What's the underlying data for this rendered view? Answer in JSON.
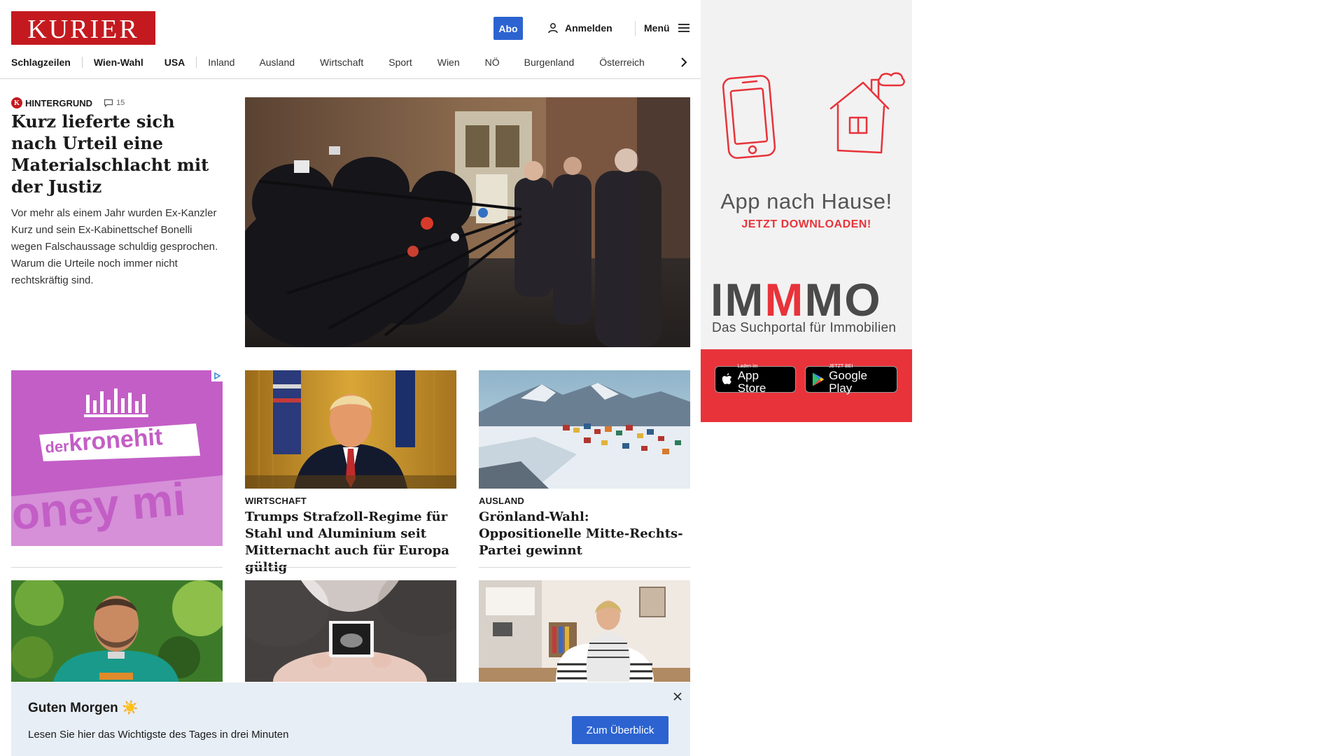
{
  "header": {
    "logo": "KURIER",
    "abo_label": "Abo",
    "login_label": "Anmelden",
    "menu_label": "Menü",
    "nav": [
      "Schlagzeilen",
      "Wien-Wahl",
      "USA",
      "Inland",
      "Ausland",
      "Wirtschaft",
      "Sport",
      "Wien",
      "NÖ",
      "Burgenland",
      "Österreich"
    ]
  },
  "lead": {
    "kicker": "HINTERGRUND",
    "comments": "15",
    "title": "Kurz lieferte sich nach Urteil eine Materialschlacht mit der Justiz",
    "teaser": "Vor mehr als einem Jahr wurden Ex-Kanzler Kurz und sein Ex-Kabinettschef Bonelli wegen Falschaussage schuldig gesprochen. Warum die Urteile noch immer nicht rechtskräftig sind."
  },
  "ad_kronehit": {
    "brand_pre": "der",
    "brand": "kronehit",
    "slogan_fragment": "oney mi"
  },
  "cards": [
    {
      "kicker": "WIRTSCHAFT",
      "title": "Trumps Strafzoll-Regime für Stahl und Aluminium seit Mitternacht auch für Europa gültig"
    },
    {
      "kicker": "AUSLAND",
      "title": "Grönland-Wahl: Oppositionelle Mitte-Rechts-Partei gewinnt"
    }
  ],
  "side_ad": {
    "headline": "App nach Hause!",
    "sub": "JETZT DOWNLOADEN!",
    "brand_a": "IM",
    "brand_b": "M",
    "brand_c": "MO",
    "tagline": "Das Suchportal für Immobilien",
    "appstore_small": "Laden im",
    "appstore_big": "App Store",
    "gplay_small": "JETZT BEI",
    "gplay_big": "Google Play"
  },
  "toast": {
    "title": "Guten Morgen ☀️",
    "text": "Lesen Sie hier das Wichtigste des Tages in drei Minuten",
    "button": "Zum Überblick"
  }
}
